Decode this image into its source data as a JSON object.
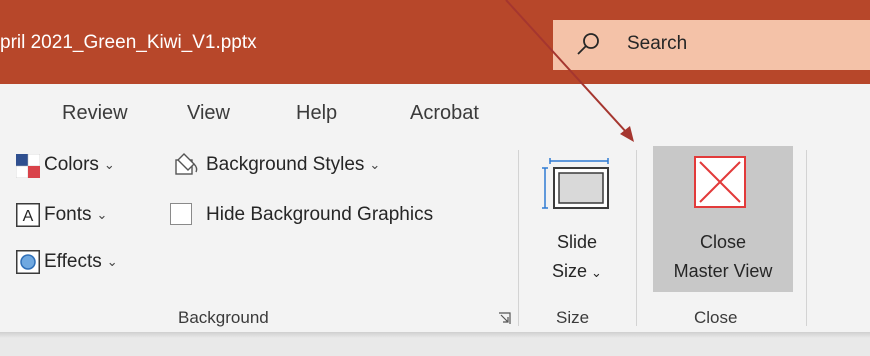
{
  "window": {
    "title": "pril 2021_Green_Kiwi_V1.pptx",
    "accent_color": "#b7472a"
  },
  "search": {
    "placeholder": "Search",
    "icon": "search-icon"
  },
  "tabs": [
    {
      "label": "Review"
    },
    {
      "label": "View"
    },
    {
      "label": "Help"
    },
    {
      "label": "Acrobat"
    }
  ],
  "background_group": {
    "label": "Background",
    "colors": {
      "label": "Colors",
      "icon": "colors-icon"
    },
    "fonts": {
      "label": "Fonts",
      "icon": "fonts-icon"
    },
    "effects": {
      "label": "Effects",
      "icon": "effects-icon"
    },
    "background_styles": {
      "label": "Background Styles",
      "icon": "background-styles-icon"
    },
    "hide_graphics": {
      "label": "Hide Background Graphics",
      "checked": false
    }
  },
  "size_group": {
    "label": "Size",
    "slide_size": {
      "line1": "Slide",
      "line2": "Size",
      "icon": "slide-size-icon"
    }
  },
  "close_group": {
    "label": "Close",
    "close_master": {
      "line1": "Close",
      "line2": "Master View",
      "icon": "close-master-view-icon"
    }
  },
  "annotation": {
    "arrow_color": "#a5362f"
  }
}
